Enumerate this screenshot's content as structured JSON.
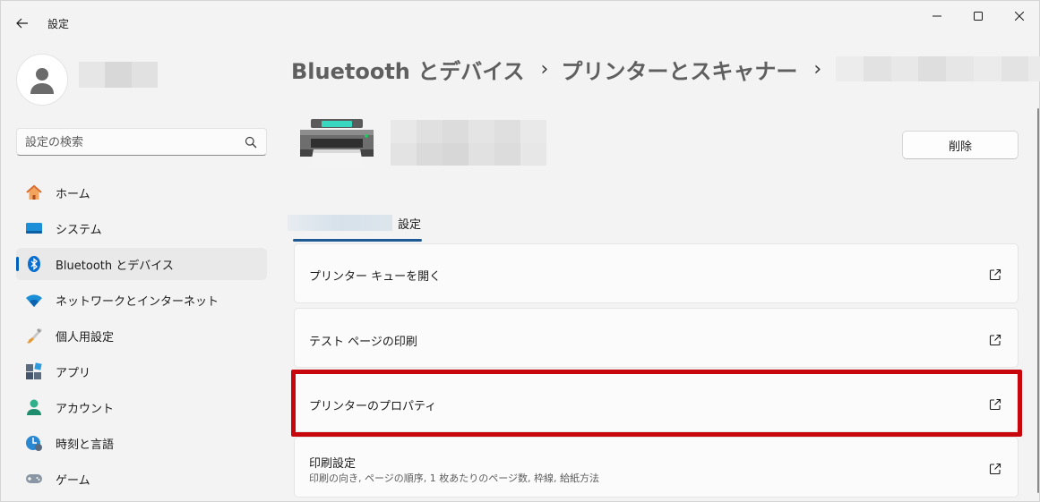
{
  "app": {
    "title": "設定"
  },
  "search": {
    "placeholder": "設定の検索"
  },
  "sidebar": {
    "items": [
      {
        "label": "ホーム",
        "icon": "home-icon"
      },
      {
        "label": "システム",
        "icon": "system-icon"
      },
      {
        "label": "Bluetooth とデバイス",
        "icon": "bluetooth-icon",
        "active": true
      },
      {
        "label": "ネットワークとインターネット",
        "icon": "wifi-icon"
      },
      {
        "label": "個人用設定",
        "icon": "brush-icon"
      },
      {
        "label": "アプリ",
        "icon": "apps-icon"
      },
      {
        "label": "アカウント",
        "icon": "account-icon"
      },
      {
        "label": "時刻と言語",
        "icon": "time-language-icon"
      },
      {
        "label": "ゲーム",
        "icon": "gamepad-icon"
      }
    ]
  },
  "breadcrumb": {
    "items": [
      "Bluetooth とデバイス",
      "プリンターとスキャナー"
    ],
    "separator": "›"
  },
  "device": {
    "delete_label": "削除"
  },
  "tabs": {
    "settings_label": "設定"
  },
  "cards": [
    {
      "title": "プリンター キューを開く",
      "desc": ""
    },
    {
      "title": "テスト ページの印刷",
      "desc": ""
    },
    {
      "title": "プリンターのプロパティ",
      "desc": ""
    },
    {
      "title": "印刷設定",
      "desc": "印刷の向き, ページの順序, 1 枚あたりのページ数, 枠線, 給紙方法"
    }
  ],
  "colors": {
    "accent": "#005fb8",
    "highlight": "#c8070c",
    "background": "#f3f3f3"
  }
}
